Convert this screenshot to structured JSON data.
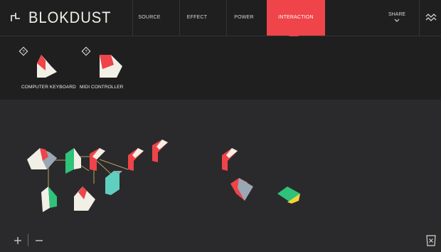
{
  "app": {
    "name": "BLOKDUST",
    "logo_icon": "blokdust-logo-icon",
    "accent_color": "#ef4449"
  },
  "nav": {
    "tabs": [
      {
        "id": "source",
        "label": "SOURCE",
        "active": false
      },
      {
        "id": "effect",
        "label": "EFFECT",
        "active": false
      },
      {
        "id": "power",
        "label": "POWER",
        "active": false
      },
      {
        "id": "interaction",
        "label": "INTERACTION",
        "active": true
      }
    ],
    "share_label": "SHARE",
    "share_icon": "chevron-down-icon",
    "settings_icon": "waves-menu-icon"
  },
  "panel": {
    "items": [
      {
        "label": "COMPUTER KEYBOARD",
        "help_icon": "question-diamond-icon",
        "block_icon": "keyboard-block-icon"
      },
      {
        "label": "MIDI CONTROLLER",
        "help_icon": "question-diamond-icon",
        "block_icon": "midi-block-icon"
      }
    ],
    "help_text": "?"
  },
  "footer": {
    "zoom_in_label": "+",
    "zoom_out_label": "−",
    "trash_icon": "trash-x-icon"
  },
  "colors": {
    "red": "#ef4449",
    "cream": "#f2efe6",
    "gray_blue": "#9aa8b4",
    "green": "#2fc27a",
    "mint": "#7fe0c9",
    "teal": "#5fcfc0",
    "yellow": "#f0d438",
    "connection": "#b3a25d"
  }
}
